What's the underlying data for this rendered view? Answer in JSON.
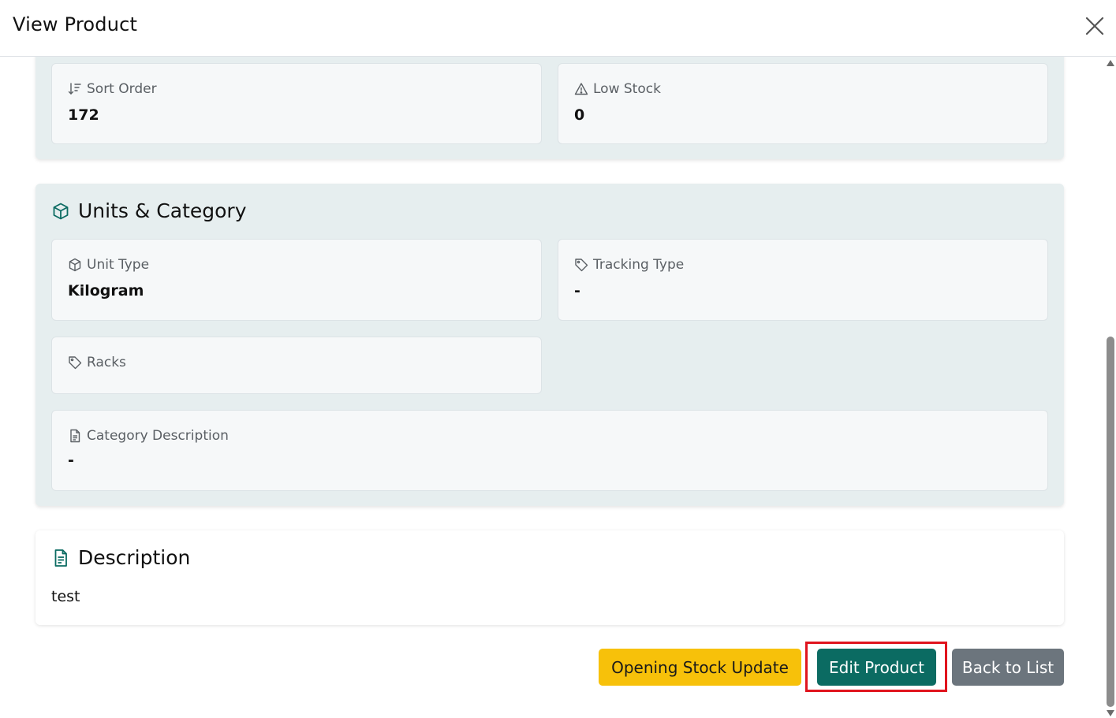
{
  "modal": {
    "title": "View Product"
  },
  "stock_fields": {
    "sort_order": {
      "label": "Sort Order",
      "value": "172",
      "icon": "sort-descending-icon"
    },
    "low_stock": {
      "label": "Low Stock",
      "value": "0",
      "icon": "warning-triangle-icon"
    }
  },
  "units_category": {
    "title": "Units & Category",
    "icon": "cube-icon",
    "unit_type": {
      "label": "Unit Type",
      "value": "Kilogram",
      "icon": "cube-icon"
    },
    "tracking_type": {
      "label": "Tracking Type",
      "value": "-",
      "icon": "tag-icon"
    },
    "racks": {
      "label": "Racks",
      "value": "",
      "icon": "tag-icon"
    },
    "category_description": {
      "label": "Category Description",
      "value": "-",
      "icon": "document-icon"
    }
  },
  "description": {
    "title": "Description",
    "icon": "document-icon",
    "text": "test"
  },
  "actions": {
    "opening_stock_update": "Opening Stock Update",
    "edit_product": "Edit Product",
    "back_to_list": "Back to List"
  },
  "colors": {
    "accent_teal": "#0b6b62",
    "warning_yellow": "#f7c10a",
    "secondary_gray": "#6c757d",
    "section_bg": "#e6eeef",
    "highlight_red": "#e0141e"
  }
}
